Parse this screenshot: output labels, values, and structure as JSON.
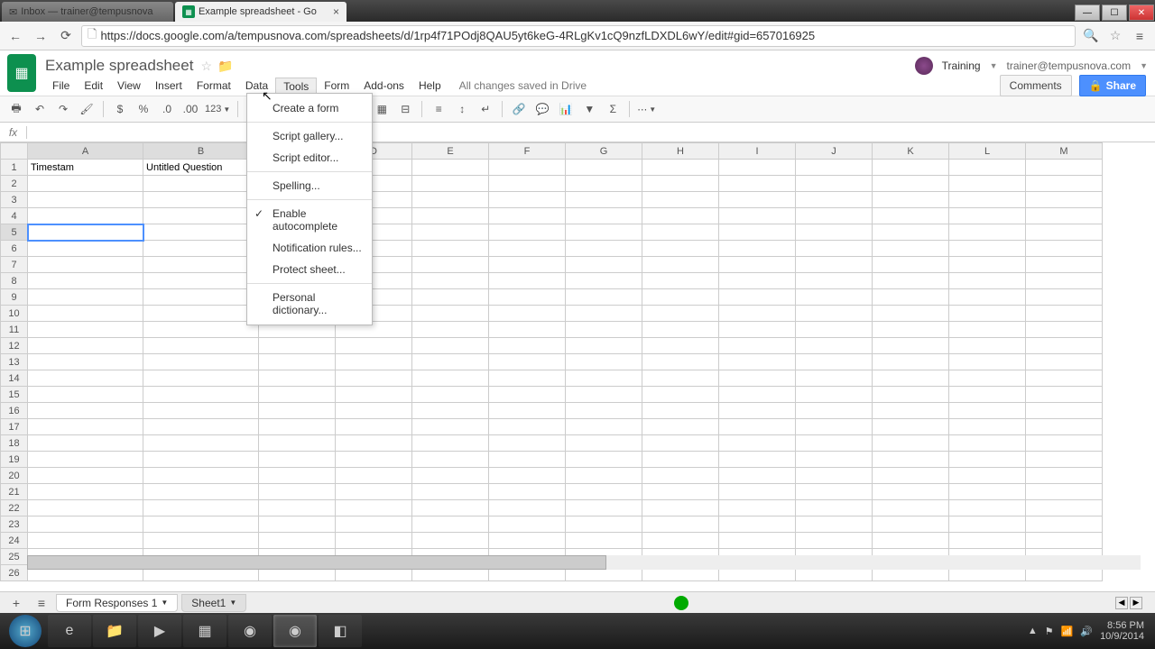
{
  "browser": {
    "tab1_title": "Inbox — trainer@tempusnova",
    "tab2_title": "Example spreadsheet - Go",
    "url": "https://docs.google.com/a/tempusnova.com/spreadsheets/d/1rp4f71POdj8QAU5yt6keG-4RLgKv1cQ9nzfLDXDL6wY/edit#gid=657016925"
  },
  "header": {
    "doc_title": "Example spreadsheet",
    "user_name": "Training",
    "user_email": "trainer@tempusnova.com",
    "comments": "Comments",
    "share": "Share"
  },
  "menus": [
    "File",
    "Edit",
    "View",
    "Insert",
    "Format",
    "Data",
    "Tools",
    "Form",
    "Add-ons",
    "Help"
  ],
  "save_status": "All changes saved in Drive",
  "tools_menu": {
    "create_form": "Create a form",
    "script_gallery": "Script gallery...",
    "script_editor": "Script editor...",
    "spelling": "Spelling...",
    "autocomplete": "Enable autocomplete",
    "notification": "Notification rules...",
    "protect": "Protect sheet...",
    "dictionary": "Personal dictionary..."
  },
  "toolbar": {
    "fmt_123": "123"
  },
  "fx": {
    "label": "fx"
  },
  "columns": [
    "A",
    "B",
    "C",
    "D",
    "E",
    "F",
    "G",
    "H",
    "I",
    "J",
    "K",
    "L",
    "M"
  ],
  "rows": 26,
  "cells": {
    "A1": "Timestam",
    "B1": "Untitled Question"
  },
  "sheet_tabs": {
    "active": "Form Responses 1",
    "other": "Sheet1"
  },
  "taskbar": {
    "time": "8:56 PM",
    "date": "10/9/2014"
  }
}
